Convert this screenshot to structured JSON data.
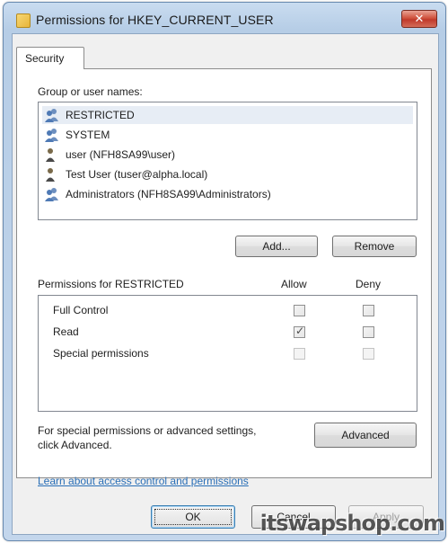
{
  "window": {
    "title": "Permissions for HKEY_CURRENT_USER",
    "close_glyph": "✕",
    "title_icon": "folder-icon"
  },
  "tabs": [
    {
      "label": "Security",
      "selected": true
    }
  ],
  "groups": {
    "label": "Group or user names:",
    "items": [
      {
        "label": "RESTRICTED",
        "icon": "group-icon",
        "selected": true
      },
      {
        "label": "SYSTEM",
        "icon": "group-icon",
        "selected": false
      },
      {
        "label": "user (NFH8SA99\\user)",
        "icon": "user-icon",
        "selected": false
      },
      {
        "label": "Test User (tuser@alpha.local)",
        "icon": "user-icon",
        "selected": false
      },
      {
        "label": "Administrators (NFH8SA99\\Administrators)",
        "icon": "group-icon",
        "selected": false
      }
    ],
    "add_label": "Add...",
    "remove_label": "Remove"
  },
  "permissions": {
    "header": "Permissions for RESTRICTED",
    "allow_label": "Allow",
    "deny_label": "Deny",
    "rows": [
      {
        "name": "Full Control",
        "allow": false,
        "deny": false,
        "enabled": true
      },
      {
        "name": "Read",
        "allow": true,
        "deny": false,
        "enabled": true
      },
      {
        "name": "Special permissions",
        "allow": false,
        "deny": false,
        "enabled": false
      }
    ]
  },
  "advanced": {
    "text_line1": "For special permissions or advanced settings,",
    "text_line2": "click Advanced.",
    "button_label": "Advanced"
  },
  "link_text": "Learn about access control and permissions",
  "footer": {
    "ok_label": "OK",
    "cancel_label": "Cancel",
    "apply_label": "Apply"
  },
  "watermark": "itswapshop.com",
  "colors": {
    "link": "#2a6fb7",
    "selection": "#e7edf5",
    "close_button": "#c0392b"
  }
}
